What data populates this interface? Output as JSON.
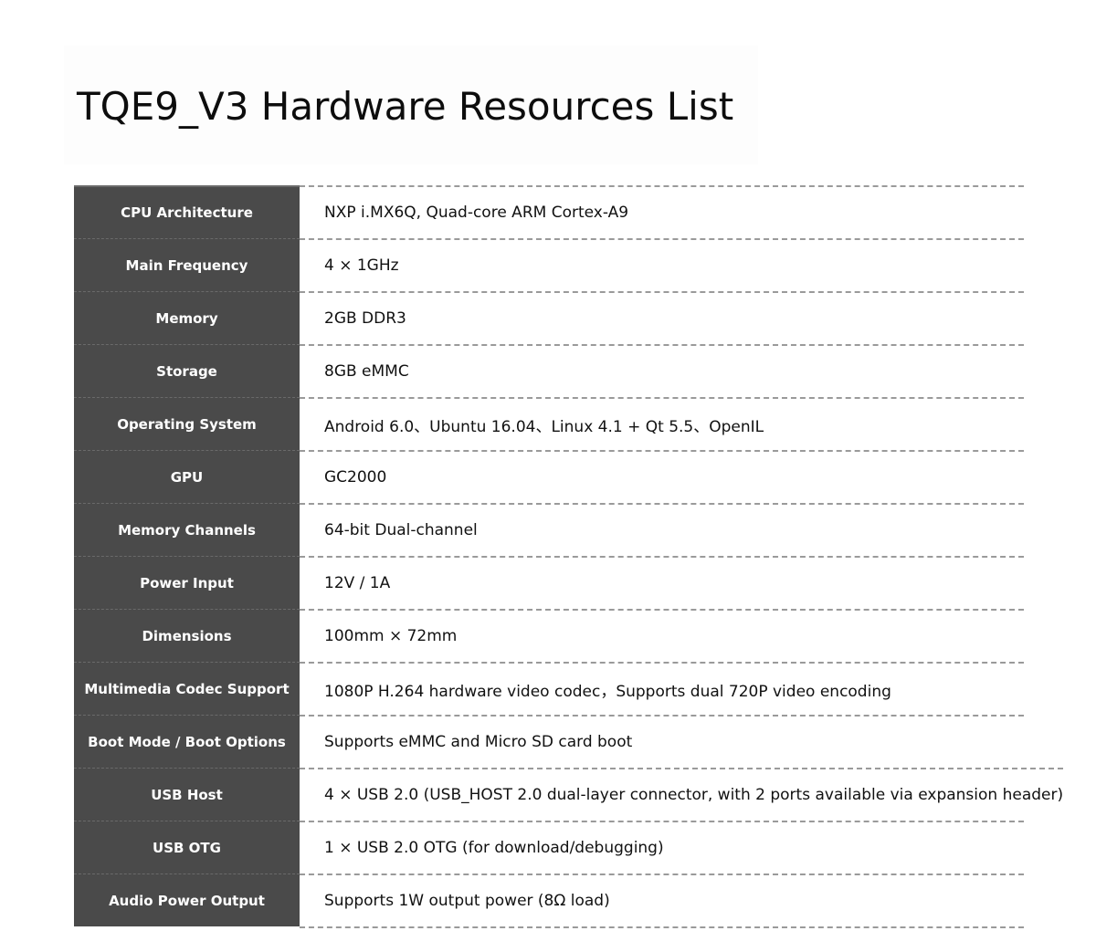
{
  "title": "TQE9_V3 Hardware Resources List",
  "specs": [
    {
      "label": "CPU Architecture",
      "value": "NXP i.MX6Q, Quad-core ARM Cortex-A9"
    },
    {
      "label": "Main Frequency",
      "value": "4 × 1GHz"
    },
    {
      "label": "Memory",
      "value": "2GB DDR3"
    },
    {
      "label": "Storage",
      "value": "8GB eMMC"
    },
    {
      "label": "Operating System",
      "value": "Android 6.0、Ubuntu 16.04、Linux 4.1 + Qt 5.5、OpenIL"
    },
    {
      "label": "GPU",
      "value": "GC2000"
    },
    {
      "label": "Memory Channels",
      "value": "64-bit Dual-channel"
    },
    {
      "label": "Power Input",
      "value": "12V / 1A"
    },
    {
      "label": "Dimensions",
      "value": "100mm × 72mm"
    },
    {
      "label": "Multimedia Codec Support",
      "value": "1080P H.264 hardware video codec，Supports dual 720P video encoding"
    },
    {
      "label": "Boot Mode / Boot Options",
      "value": "Supports eMMC and Micro SD card boot"
    },
    {
      "label": "USB Host",
      "value": "4 × USB 2.0 (USB_HOST 2.0 dual-layer connector, with 2 ports available via expansion header)"
    },
    {
      "label": "USB OTG",
      "value": "1 × USB 2.0 OTG (for download/debugging)"
    },
    {
      "label": "Audio Power Output",
      "value": "Supports 1W output power (8Ω load)"
    }
  ]
}
